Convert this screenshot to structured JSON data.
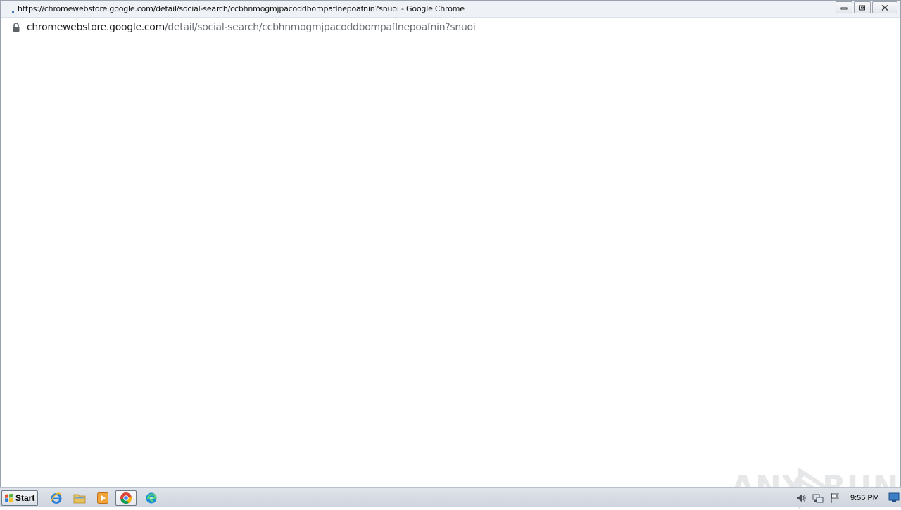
{
  "window": {
    "title": "https://chromewebstore.google.com/detail/social-search/ccbhnmogmjpacoddbompaflnepoafnin?snuoi - Google Chrome"
  },
  "address": {
    "host": "chromewebstore.google.com",
    "path": "/detail/social-search/ccbhnmogmjpacoddbompaflnepoafnin?snuoi"
  },
  "watermark": {
    "text_left": "ANY",
    "text_right": "RUN"
  },
  "taskbar": {
    "start_label": "Start",
    "pinned": [
      {
        "name": "internet-explorer-icon"
      },
      {
        "name": "file-explorer-icon"
      },
      {
        "name": "media-player-icon"
      },
      {
        "name": "chrome-icon",
        "active": true
      },
      {
        "name": "edge-icon"
      }
    ],
    "clock": "9:55 PM"
  }
}
